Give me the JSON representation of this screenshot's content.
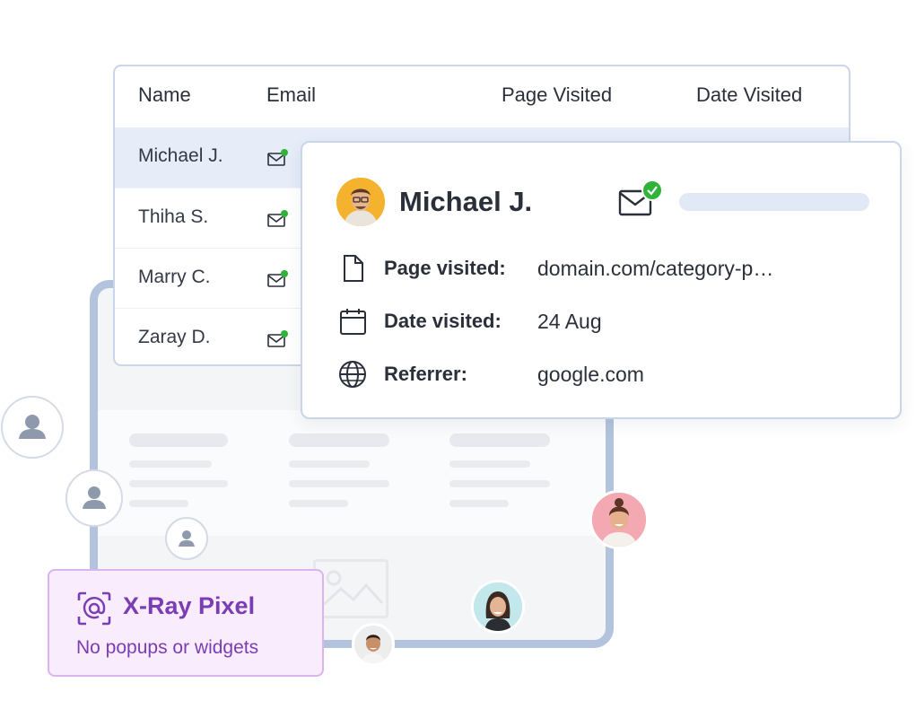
{
  "table": {
    "headers": [
      "Name",
      "Email",
      "Page Visited",
      "Date Visited"
    ],
    "rows": [
      {
        "name": "Michael J.",
        "selected": true
      },
      {
        "name": "Thiha S.",
        "selected": false
      },
      {
        "name": "Marry C.",
        "selected": false
      },
      {
        "name": "Zaray D.",
        "selected": false
      }
    ]
  },
  "detail": {
    "name": "Michael J.",
    "fields": [
      {
        "icon": "page-icon",
        "label": "Page visited:",
        "value": "domain.com/category-p…"
      },
      {
        "icon": "calendar-icon",
        "label": "Date visited:",
        "value": "24 Aug"
      },
      {
        "icon": "globe-icon",
        "label": "Referrer:",
        "value": "google.com"
      }
    ]
  },
  "badge": {
    "icon": "at-scan-icon",
    "title": "X-Ray Pixel",
    "subtitle": "No popups or widgets"
  },
  "colors": {
    "accent_purple": "#7b3db4",
    "status_green": "#2fb339",
    "frame_blue": "#b3c3dd",
    "selected_row": "#e6ecf8"
  }
}
